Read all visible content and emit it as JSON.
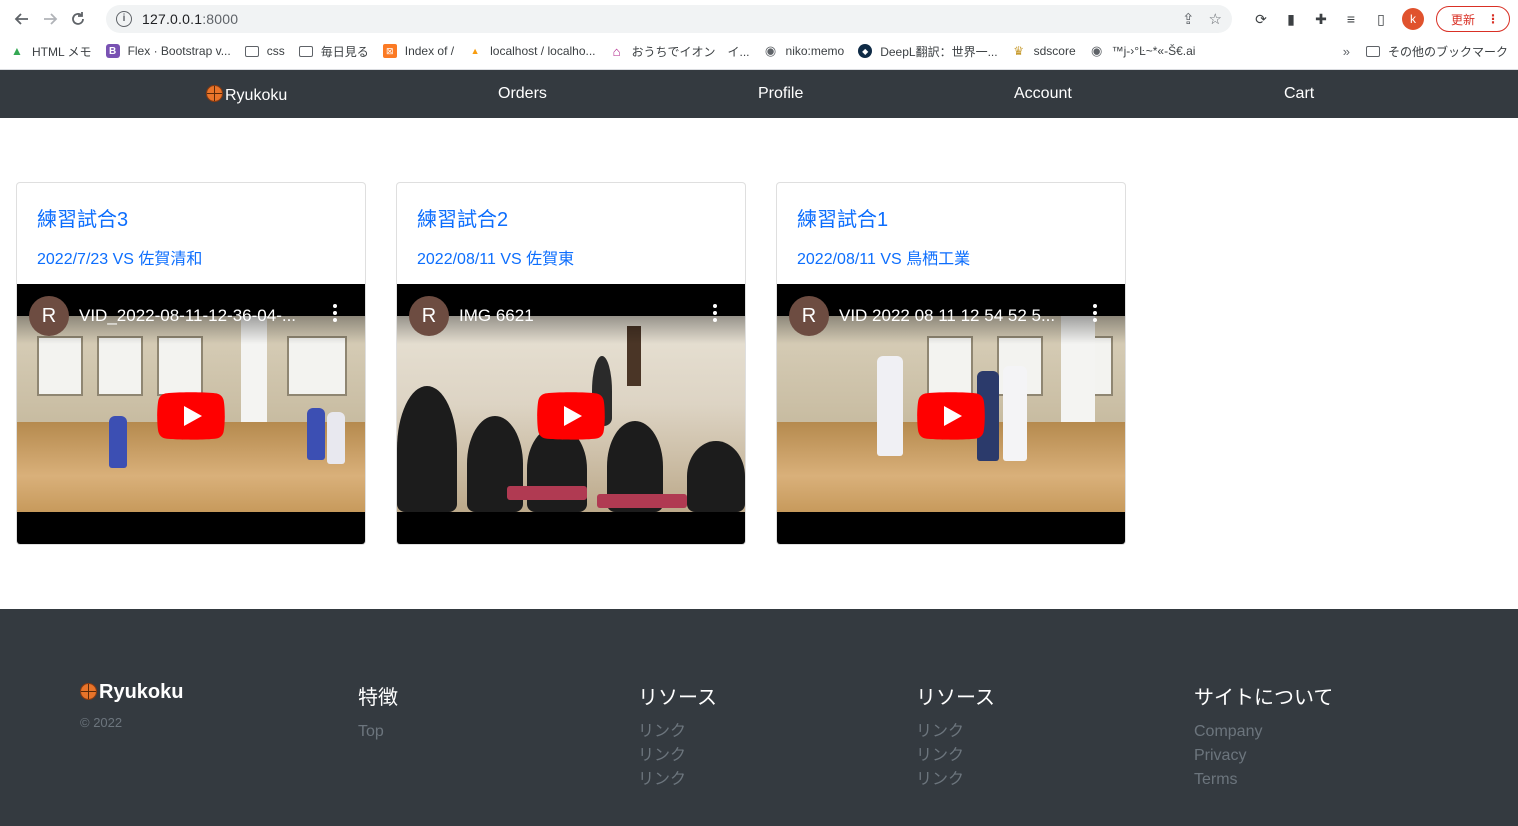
{
  "browser": {
    "url_host": "127.0.0.1",
    "url_port": ":8000",
    "avatar_letter": "k",
    "update_label": "更新",
    "bookmarks": [
      {
        "icon": "drive-icon",
        "label": "HTML メモ"
      },
      {
        "icon": "bootstrap-icon",
        "label": "Flex · Bootstrap v..."
      },
      {
        "icon": "folder-icon",
        "label": "css"
      },
      {
        "icon": "folder-icon",
        "label": "毎日見る"
      },
      {
        "icon": "xampp-icon",
        "label": "Index of /"
      },
      {
        "icon": "phpmyadmin-icon",
        "label": "localhost / localho..."
      },
      {
        "icon": "home-icon",
        "label": "おうちでイオン　イ..."
      },
      {
        "icon": "globe-icon",
        "label": "niko:memo"
      },
      {
        "icon": "deepl-icon",
        "label": "DeepL翻訳：世界一..."
      },
      {
        "icon": "sdscore-icon",
        "label": "sdscore"
      },
      {
        "icon": "globe-icon",
        "label": "™j-›°Ŀ~*«-Š€.ai"
      }
    ],
    "more_bookmarks": "»",
    "other_bookmarks": "その他のブックマーク"
  },
  "nav": {
    "brand": "Ryukoku",
    "items": [
      "Orders",
      "Profile",
      "Account",
      "Cart"
    ]
  },
  "cards": [
    {
      "title": "練習試合3",
      "subtitle": "2022/7/23 VS 佐賀清和",
      "video_title": "VID_2022-08-11-12-36-04-...",
      "channel_initial": "R"
    },
    {
      "title": "練習試合2",
      "subtitle": "2022/08/11 VS 佐賀東",
      "video_title": "IMG 6621",
      "channel_initial": "R"
    },
    {
      "title": "練習試合1",
      "subtitle": "2022/08/11 VS 鳥栖工業",
      "video_title": "VID 2022 08 11 12 54 52 5...",
      "channel_initial": "R"
    }
  ],
  "footer": {
    "brand": "Ryukoku",
    "copyright": "© 2022",
    "columns": [
      {
        "heading": "特徴",
        "links": [
          "Top"
        ]
      },
      {
        "heading": "リソース",
        "links": [
          "リンク",
          "リンク",
          "リンク"
        ]
      },
      {
        "heading": "リソース",
        "links": [
          "リンク",
          "リンク",
          "リンク"
        ]
      },
      {
        "heading": "サイトについて",
        "links": [
          "Company",
          "Privacy",
          "Terms"
        ]
      }
    ]
  },
  "colors": {
    "navbar_bg": "#343a40",
    "link_blue": "#0d6efd",
    "footer_link": "#6c757d",
    "youtube_red": "#ff0000"
  }
}
